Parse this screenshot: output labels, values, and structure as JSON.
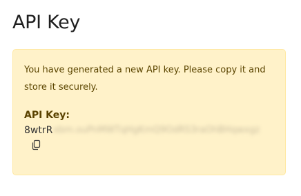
{
  "page": {
    "title": "API Key"
  },
  "alert": {
    "message": "You have generated a new API key. Please copy it and store it securely.",
    "key_label": "API Key:",
    "key_visible": "8wtrR",
    "key_hidden": "xbm.ouPnMWTqHgKmQ9OdRS3raOhBHqwxgz",
    "copy_icon": "copy-icon"
  },
  "colors": {
    "alert_bg": "#fff2c9",
    "alert_border": "#ffe8a1",
    "alert_text": "#5b4500"
  }
}
